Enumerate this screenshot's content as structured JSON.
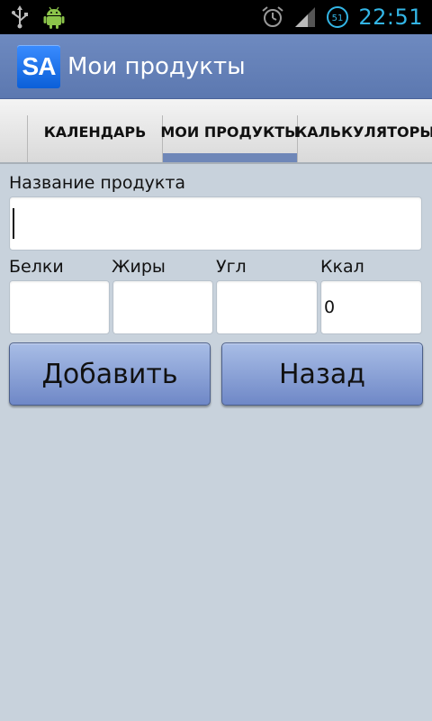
{
  "status_bar": {
    "time": "22:51",
    "battery_level": "51",
    "left_icons": [
      "usb-icon",
      "android-debug-icon"
    ],
    "right_icons": [
      "alarm-icon",
      "signal-icon",
      "battery-icon"
    ],
    "time_color": "#33b5e5"
  },
  "action_bar": {
    "logo_text": "SA",
    "title": "Мои продукты",
    "color": "#6e8ac0"
  },
  "tabs": [
    {
      "label": "КАЛЕНДАРЬ",
      "selected": false
    },
    {
      "label": "МОИ ПРОДУКТЫ",
      "selected": true
    },
    {
      "label": "КАЛЬКУЛЯТОРЫ",
      "selected": false
    }
  ],
  "form": {
    "name_label": "Название продукта",
    "name_value": "",
    "protein_label": "Белки",
    "protein_value": "",
    "fat_label": "Жиры",
    "fat_value": "",
    "carbs_label": "Угл",
    "carbs_value": "",
    "kcal_label": "Ккал",
    "kcal_value": "0"
  },
  "buttons": {
    "add_label": "Добавить",
    "back_label": "Назад"
  }
}
